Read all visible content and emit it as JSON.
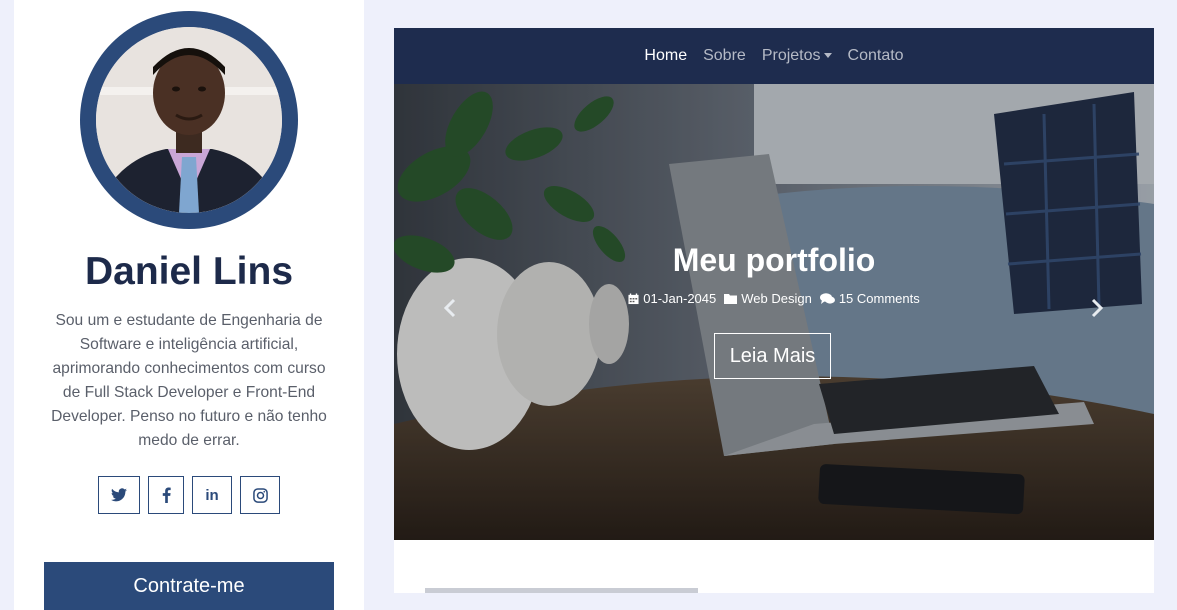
{
  "profile": {
    "name": "Daniel Lins",
    "bio": "Sou um e estudante de Engenharia de Software e inteligência artificial, aprimorando conhecimentos com curso de Full Stack Developer e Front-End Developer. Penso no futuro e não tenho medo de errar.",
    "socials": [
      {
        "icon": "twitter-icon"
      },
      {
        "icon": "facebook-icon"
      },
      {
        "icon": "linkedin-icon",
        "label": "in"
      },
      {
        "icon": "instagram-icon"
      }
    ],
    "hire_label": "Contrate-me"
  },
  "nav": {
    "items": [
      {
        "label": "Home"
      },
      {
        "label": "Sobre"
      },
      {
        "label": "Projetos"
      },
      {
        "label": "Contato"
      }
    ]
  },
  "hero": {
    "title": "Meu portfolio",
    "date": "01-Jan-2045",
    "category": "Web Design",
    "comments": "15 Comments",
    "button_label": "Leia Mais"
  },
  "colors": {
    "primary": "#2b4a7a",
    "navbar": "#1e2c4e",
    "page_bg": "#eef0fb",
    "name": "#1d2a4a"
  }
}
